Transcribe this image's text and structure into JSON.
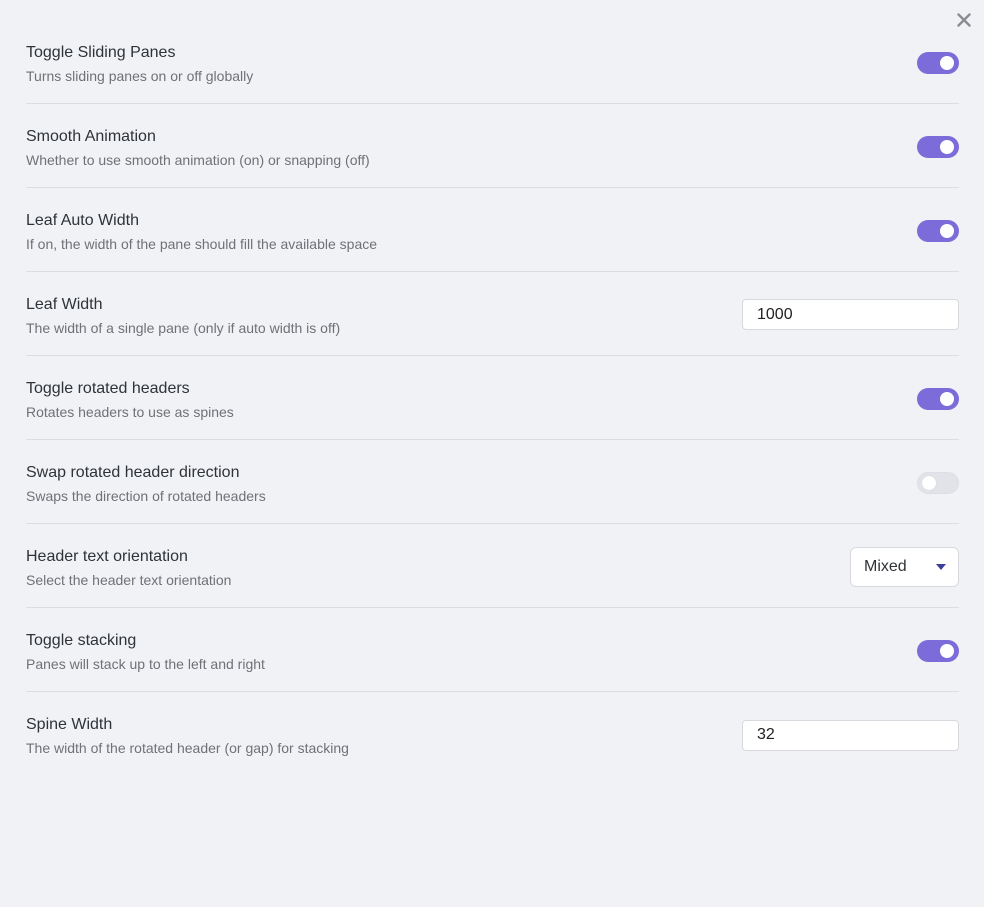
{
  "close_icon_label": "close-icon",
  "settings": [
    {
      "name": "Toggle Sliding Panes",
      "desc": "Turns sliding panes on or off globally",
      "control": "toggle",
      "enabled": true
    },
    {
      "name": "Smooth Animation",
      "desc": "Whether to use smooth animation (on) or snapping (off)",
      "control": "toggle",
      "enabled": true
    },
    {
      "name": "Leaf Auto Width",
      "desc": "If on, the width of the pane should fill the available space",
      "control": "toggle",
      "enabled": true
    },
    {
      "name": "Leaf Width",
      "desc": "The width of a single pane (only if auto width is off)",
      "control": "text",
      "value": "1000"
    },
    {
      "name": "Toggle rotated headers",
      "desc": "Rotates headers to use as spines",
      "control": "toggle",
      "enabled": true
    },
    {
      "name": "Swap rotated header direction",
      "desc": "Swaps the direction of rotated headers",
      "control": "toggle",
      "enabled": false
    },
    {
      "name": "Header text orientation",
      "desc": "Select the header text orientation",
      "control": "dropdown",
      "value": "Mixed"
    },
    {
      "name": "Toggle stacking",
      "desc": "Panes will stack up to the left and right",
      "control": "toggle",
      "enabled": true
    },
    {
      "name": "Spine Width",
      "desc": "The width of the rotated header (or gap) for stacking",
      "control": "text",
      "value": "32"
    }
  ],
  "colors": {
    "accent": "#7b6cd9",
    "background": "#f1f2f5",
    "toggle_off": "#e2e3e8"
  }
}
